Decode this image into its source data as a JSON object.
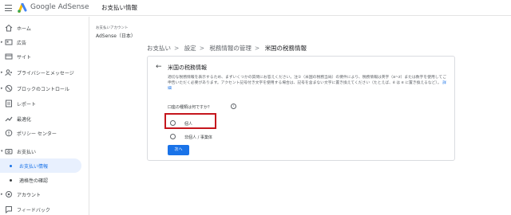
{
  "header": {
    "brand_google": "Google",
    "brand_product": "AdSense",
    "page_title": "お支払い情報"
  },
  "sidebar": {
    "items": [
      {
        "label": "ホーム",
        "icon": "home-icon"
      },
      {
        "label": "広告",
        "icon": "ads-icon"
      },
      {
        "label": "サイト",
        "icon": "sites-icon"
      },
      {
        "label": "プライバシーとメッセージ",
        "icon": "privacy-icon"
      },
      {
        "label": "ブロックのコントロール",
        "icon": "block-icon"
      },
      {
        "label": "レポート",
        "icon": "reports-icon"
      },
      {
        "label": "最適化",
        "icon": "optimization-icon"
      },
      {
        "label": "ポリシー センター",
        "icon": "policy-icon"
      },
      {
        "label": "お支払い",
        "icon": "payments-icon"
      },
      {
        "label": "お支払い情報",
        "icon": "dot"
      },
      {
        "label": "適格性の確認",
        "icon": "dot"
      },
      {
        "label": "アカウント",
        "icon": "account-icon"
      },
      {
        "label": "フィードバック",
        "icon": "feedback-icon"
      }
    ]
  },
  "account": {
    "caption": "お支払いアカウント",
    "name": "AdSense（日本）"
  },
  "breadcrumb": [
    "お支払い",
    "設定",
    "税務情報の管理",
    "米国の税務情報"
  ],
  "card": {
    "title": "米国の税務情報",
    "description": "適切な税務情報を表示するため、まずいくつかの質問にお答えください。注①（米国の税務当局）の要件により、税務情報は英字（a~z）または数字を使用してご申告いただく必要があります。アクセント記号付き文字を使用する場合は、記号を含まない文字に置き換えてください（たとえば、é は e に置き換えるなど）。",
    "link": "詳細",
    "question": "口座の種類は何ですか？",
    "options": [
      "個人",
      "非個人 / 事業体"
    ],
    "next_label": "次へ"
  },
  "colors": {
    "accent": "#1a73e8",
    "highlight": "#c5161d"
  }
}
